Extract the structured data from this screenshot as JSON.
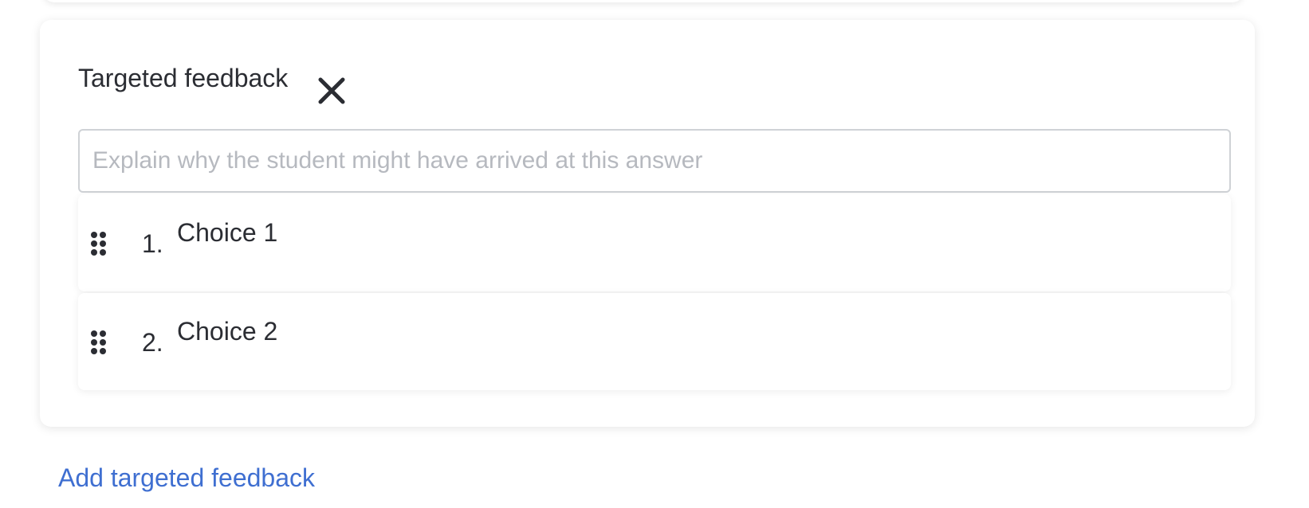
{
  "feedback": {
    "title": "Targeted feedback",
    "close_icon": "close-icon",
    "input_value": "",
    "input_placeholder": "Explain why the student might have arrived at this answer",
    "choices": [
      {
        "number": "1.",
        "label": "Choice 1",
        "handle_icon": "drag-handle-icon"
      },
      {
        "number": "2.",
        "label": "Choice 2",
        "handle_icon": "drag-handle-icon"
      }
    ]
  },
  "add_feedback_link": "Add targeted feedback",
  "colors": {
    "text": "#2b2d33",
    "link": "#3f6fd1",
    "placeholder": "#b6b9bf",
    "input_border": "#cfd2d6"
  }
}
